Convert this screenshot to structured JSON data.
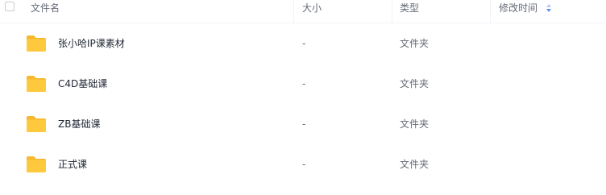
{
  "header": {
    "name_label": "文件名",
    "size_label": "大小",
    "type_label": "类型",
    "mtime_label": "修改时间",
    "sort_icon": "sort-arrows-icon",
    "sort_color": "#5b8ff9"
  },
  "files": [
    {
      "name": "张小哈IP课素材",
      "size": "-",
      "type": "文件夹",
      "icon": "folder-icon"
    },
    {
      "name": "C4D基础课",
      "size": "-",
      "type": "文件夹",
      "icon": "folder-icon"
    },
    {
      "name": "ZB基础课",
      "size": "-",
      "type": "文件夹",
      "icon": "folder-icon"
    },
    {
      "name": "正式课",
      "size": "-",
      "type": "文件夹",
      "icon": "folder-icon"
    }
  ],
  "colors": {
    "folder": "#ffc93d",
    "folder_dark": "#f5b82e"
  }
}
